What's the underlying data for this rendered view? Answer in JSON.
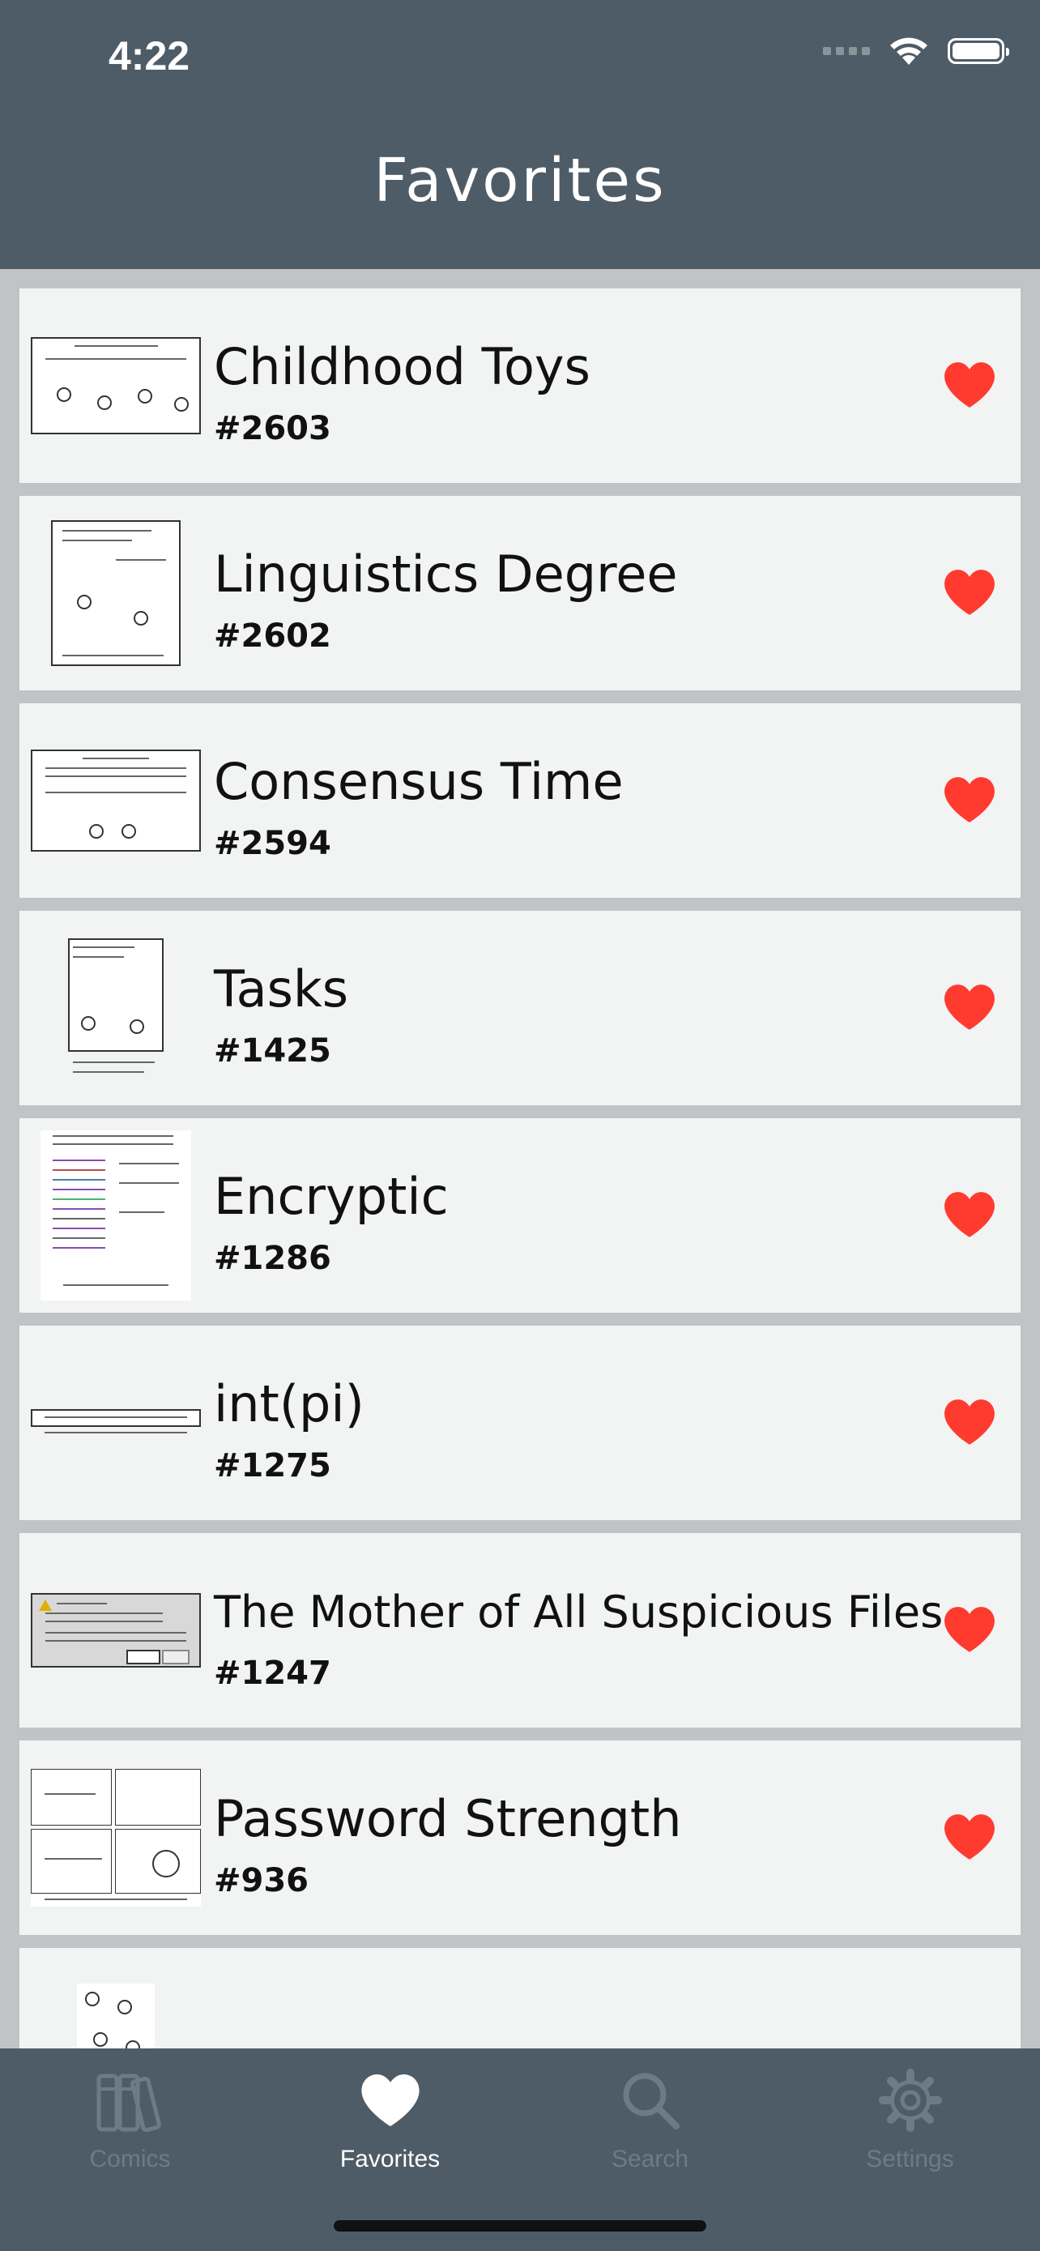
{
  "status_bar": {
    "time": "4:22"
  },
  "header": {
    "title": "Favorites"
  },
  "favorites": [
    {
      "title": "Childhood Toys",
      "number": "#2603"
    },
    {
      "title": "Linguistics Degree",
      "number": "#2602"
    },
    {
      "title": "Consensus Time",
      "number": "#2594"
    },
    {
      "title": "Tasks",
      "number": "#1425"
    },
    {
      "title": "Encryptic",
      "number": "#1286"
    },
    {
      "title": "int(pi)",
      "number": "#1275"
    },
    {
      "title": "The Mother of All Suspicious Files",
      "number": "#1247"
    },
    {
      "title": "Password Strength",
      "number": "#936"
    },
    {
      "title": "",
      "number": ""
    }
  ],
  "tabs": [
    {
      "label": "Comics",
      "icon": "books-icon"
    },
    {
      "label": "Favorites",
      "icon": "heart-icon"
    },
    {
      "label": "Search",
      "icon": "magnifier-icon"
    },
    {
      "label": "Settings",
      "icon": "gear-icon"
    }
  ],
  "colors": {
    "header_bg": "#4e5c67",
    "heart": "#ff3b30",
    "card_bg": "#f2f3f3",
    "tab_inactive": "#6f7b84",
    "tab_active": "#ffffff"
  }
}
